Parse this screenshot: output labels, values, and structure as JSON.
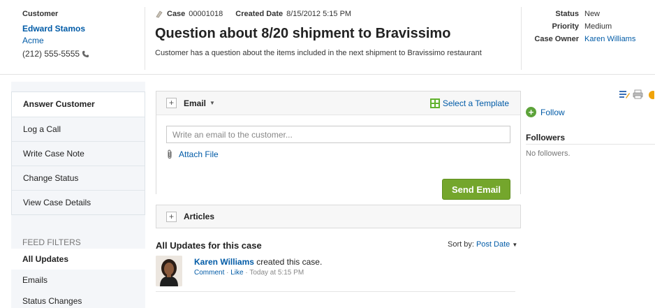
{
  "customer": {
    "label": "Customer",
    "name": "Edward Stamos",
    "account": "Acme",
    "phone": "(212) 555-5555"
  },
  "case": {
    "case_label": "Case",
    "case_number": "00001018",
    "created_label": "Created Date",
    "created_date": "8/15/2012 5:15 PM",
    "title": "Question about 8/20 shipment to Bravissimo",
    "description": "Customer has a question about the items included in the next shipment to Bravissimo restaurant"
  },
  "meta": {
    "status_label": "Status",
    "status": "New",
    "priority_label": "Priority",
    "priority": "Medium",
    "owner_label": "Case Owner",
    "owner": "Karen Williams"
  },
  "left_nav": {
    "items": [
      "Answer Customer",
      "Log a Call",
      "Write Case Note",
      "Change Status",
      "View Case Details"
    ]
  },
  "feed_filters": {
    "heading": "FEED FILTERS",
    "items": [
      "All Updates",
      "Emails",
      "Status Changes"
    ]
  },
  "publisher": {
    "tab_label": "Email",
    "template_link": "Select a Template",
    "placeholder": "Write an email to the customer...",
    "attach_label": "Attach File",
    "send_label": "Send Email"
  },
  "articles": {
    "label": "Articles"
  },
  "updates": {
    "title": "All Updates for this case",
    "sort_label": "Sort by:",
    "sort_value": "Post Date",
    "post": {
      "author": "Karen Williams",
      "action": "created this case.",
      "comment": "Comment",
      "like": "Like",
      "time": "Today at 5:15 PM"
    }
  },
  "sidebar": {
    "follow": "Follow",
    "followers_heading": "Followers",
    "no_followers": "No followers."
  },
  "colors": {
    "link": "#015ba7",
    "send_button": "#74a62c",
    "follow_icon": "#5da33a"
  }
}
